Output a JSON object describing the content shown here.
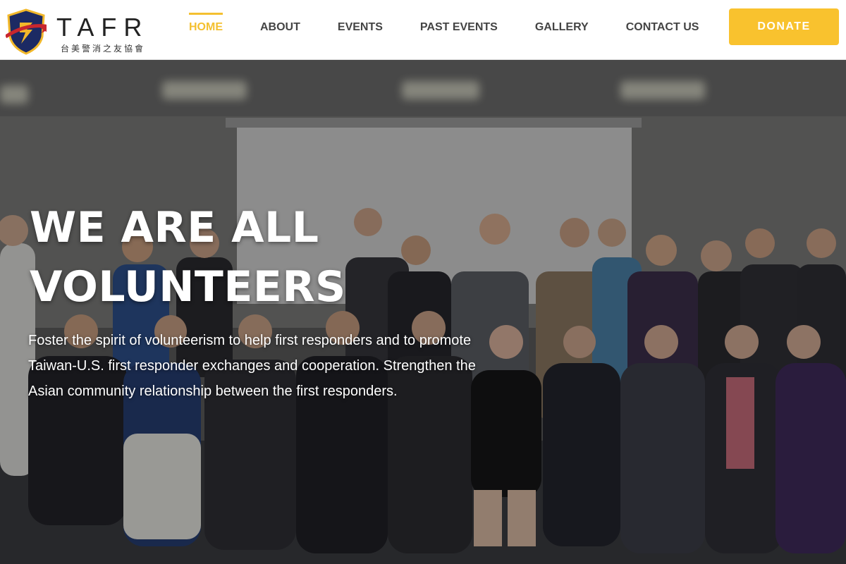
{
  "brand": {
    "name": "TAFR",
    "subtitle": "台美警消之友協會"
  },
  "nav": {
    "items": [
      {
        "label": "HOME",
        "active": true
      },
      {
        "label": "ABOUT",
        "active": false
      },
      {
        "label": "EVENTS",
        "active": false
      },
      {
        "label": "PAST EVENTS",
        "active": false
      },
      {
        "label": "GALLERY",
        "active": false
      },
      {
        "label": "CONTACT US",
        "active": false
      }
    ],
    "donate_label": "DONATE"
  },
  "hero": {
    "headline_line1": "WE ARE ALL",
    "headline_line2": "VOLUNTEERS",
    "description": "Foster the spirit of volunteerism to help first responders and to promote Taiwan-U.S. first responder exchanges and cooperation. Strengthen the Asian community relationship between the first responders."
  },
  "colors": {
    "accent": "#f4c030",
    "donate_bg": "#f9c22e",
    "nav_text": "#444444",
    "shield_navy": "#1c2a63",
    "shield_gold": "#f2b82a",
    "ribbon_red": "#c8262e"
  },
  "icons": {
    "logo": "shield-logo-icon"
  }
}
